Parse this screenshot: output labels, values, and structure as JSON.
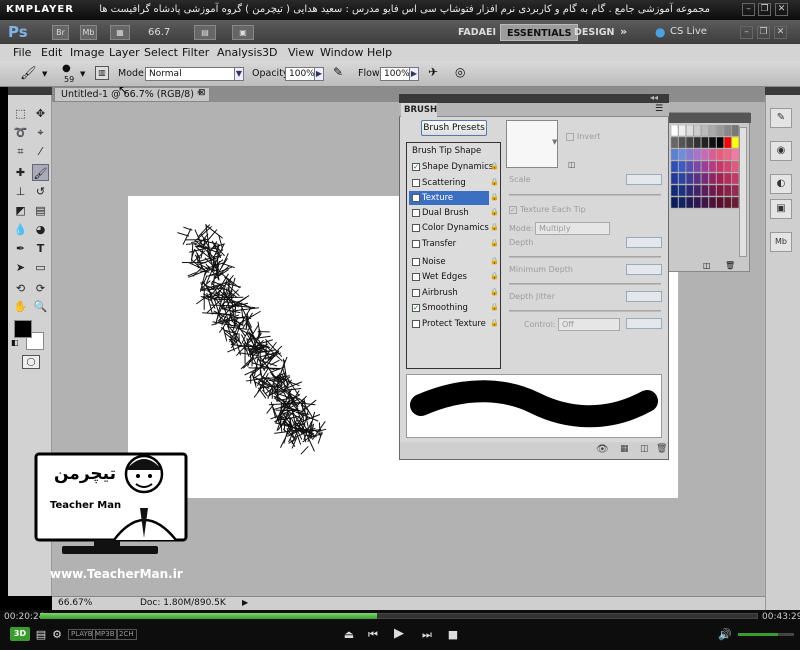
{
  "player": {
    "logo": "KMPLAYER",
    "file_title": "مجموعه آموزشی جامع . گام به گام و کاربردی نرم افزار فتوشاپ سی اس فایو مدرس : سعید هدایی ( تیچرمن ) گروه آموزشی پادشاه گرافیست ها",
    "time_elapsed": "00:20:24",
    "time_total": "00:43:29",
    "progress": 0.47,
    "chips": [
      "PLAYB",
      "MP3B",
      "2CH"
    ],
    "mode_badge": "3D"
  },
  "photoshop": {
    "logo": "Ps",
    "bridge_label": "Br",
    "mini_label": "Mb",
    "zoom": "66.7",
    "workspaces": [
      "FADAEI",
      "ESSENTIALS",
      "DESIGN"
    ],
    "active_workspace": "ESSENTIALS",
    "cs_live": "CS Live",
    "menu": [
      "File",
      "Edit",
      "Image",
      "Layer",
      "Select",
      "Filter",
      "Analysis",
      "3D",
      "View",
      "Window",
      "Help"
    ],
    "options": {
      "brush_size": "59",
      "mode_label": "Mode:",
      "mode_value": "Normal",
      "opacity_label": "Opacity:",
      "opacity_value": "100%",
      "flow_label": "Flow:",
      "flow_value": "100%"
    },
    "document": {
      "tab_label": "Untitled-1 @ 66.7% (RGB/8) *",
      "status_zoom": "66.67%",
      "status_doc": "Doc: 1.80M/890.5K"
    }
  },
  "brush_panel": {
    "tab": "BRUSH",
    "presets_button": "Brush Presets",
    "header": "Brush Tip Shape",
    "items": [
      {
        "label": "Shape Dynamics",
        "checked": true,
        "selected": false
      },
      {
        "label": "Scattering",
        "checked": false,
        "selected": false
      },
      {
        "label": "Texture",
        "checked": false,
        "selected": true
      },
      {
        "label": "Dual Brush",
        "checked": false,
        "selected": false
      },
      {
        "label": "Color Dynamics",
        "checked": false,
        "selected": false
      },
      {
        "label": "Transfer",
        "checked": false,
        "selected": false
      },
      {
        "label": "Noise",
        "checked": false,
        "selected": false
      },
      {
        "label": "Wet Edges",
        "checked": false,
        "selected": false
      },
      {
        "label": "Airbrush",
        "checked": false,
        "selected": false
      },
      {
        "label": "Smoothing",
        "checked": true,
        "selected": false
      },
      {
        "label": "Protect Texture",
        "checked": false,
        "selected": false
      }
    ],
    "invert": "Invert",
    "scale": "Scale",
    "texture_each_tip": "Texture Each Tip",
    "mode_label": "Mode:",
    "mode_value": "Multiply",
    "depth": "Depth",
    "min_depth": "Minimum Depth",
    "depth_jitter": "Depth Jitter",
    "control_label": "Control:",
    "control_value": "Off"
  },
  "watermark": {
    "logo_text": "تیچرمن",
    "sub_text": "Teacher Man",
    "url": "www.TeacherMan.ir"
  },
  "colors": {
    "accent": "#3b6fc2",
    "foreground": "#000000",
    "background": "#ffffff",
    "progress": "#3a9c2e"
  }
}
